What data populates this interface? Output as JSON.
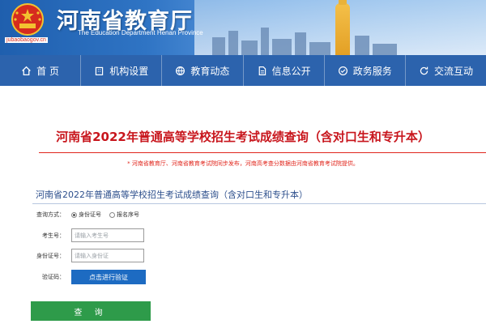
{
  "header": {
    "title": "河南省教育厅",
    "subtitle": "The Education Department Henan Province",
    "emblem_caption": "jubaobaogov.cn",
    "colors": {
      "banner": "#2f74c4",
      "emblem_red": "#d62b1e"
    }
  },
  "nav": {
    "items": [
      {
        "label": "首 页",
        "icon": "home-icon"
      },
      {
        "label": "机构设置",
        "icon": "building-icon"
      },
      {
        "label": "教育动态",
        "icon": "globe-icon"
      },
      {
        "label": "信息公开",
        "icon": "document-icon"
      },
      {
        "label": "政务服务",
        "icon": "service-icon"
      },
      {
        "label": "交流互动",
        "icon": "refresh-icon"
      }
    ],
    "color": "#2c63ad"
  },
  "main": {
    "title": "河南省2022年普通高等学校招生考试成绩查询（含对口生和专升本）",
    "notice": "* 河南省教育厅、河南省教育考试院同步发布，河南高考查分数据由河南省教育考试院提供。",
    "accent_color": "#c8161d"
  },
  "form": {
    "panel_title": "河南省2022年普通高等学校招生考试成绩查询（含对口生和专升本）",
    "method_label": "查询方式：",
    "method_options": [
      "身份证号",
      "报名序号"
    ],
    "exam_no_label": "考生号：",
    "exam_no_placeholder": "请输入考生号",
    "id_label": "身份证号：",
    "id_placeholder": "请输入身份证",
    "captcha_label": "验证码：",
    "verify_button": "点击进行验证",
    "query_button": "查 询",
    "verify_color": "#1d6bc2",
    "query_color": "#2e9b4a"
  }
}
